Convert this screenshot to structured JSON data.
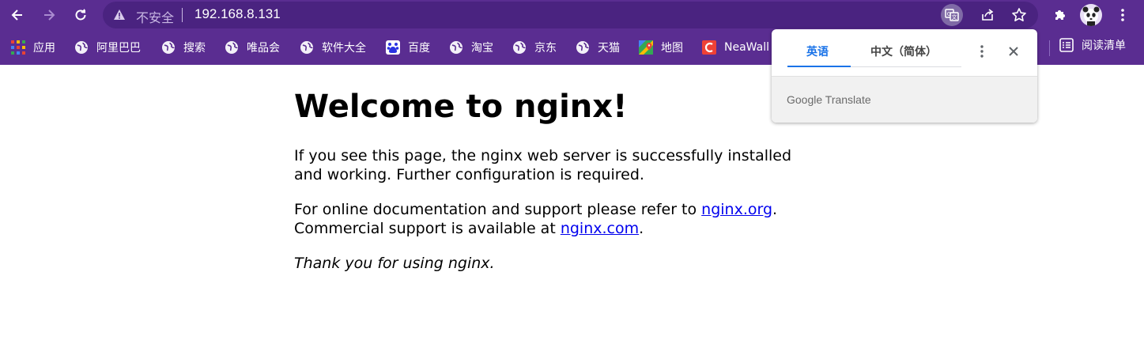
{
  "browser": {
    "url": "192.168.8.131",
    "security_label": "不安全",
    "reading_list_label": "阅读清单",
    "accent_color": "#5a2d91"
  },
  "bookmarks": [
    {
      "label": "应用",
      "icon": "apps-grid-icon"
    },
    {
      "label": "阿里巴巴",
      "icon": "globe-icon"
    },
    {
      "label": "搜索",
      "icon": "globe-icon"
    },
    {
      "label": "唯品会",
      "icon": "globe-icon"
    },
    {
      "label": "软件大全",
      "icon": "globe-icon"
    },
    {
      "label": "百度",
      "icon": "baidu-icon"
    },
    {
      "label": "淘宝",
      "icon": "globe-icon"
    },
    {
      "label": "京东",
      "icon": "globe-icon"
    },
    {
      "label": "天猫",
      "icon": "globe-icon"
    },
    {
      "label": "地图",
      "icon": "maps-icon"
    },
    {
      "label": "NeaWall",
      "icon": "neawall-icon"
    }
  ],
  "page": {
    "title": "Welcome to nginx!",
    "p1": "If you see this page, the nginx web server is successfully installed and working. Further configuration is required.",
    "p2_prefix": "For online documentation and support please refer to ",
    "link_org": "nginx.org",
    "p2_mid": ".",
    "p2_line2": "Commercial support is available at ",
    "link_com": "nginx.com",
    "p2_end": ".",
    "p3": "Thank you for using nginx."
  },
  "translate_popup": {
    "tab_source": "英语",
    "tab_target": "中文（简体）",
    "brand": "Google Translate"
  }
}
